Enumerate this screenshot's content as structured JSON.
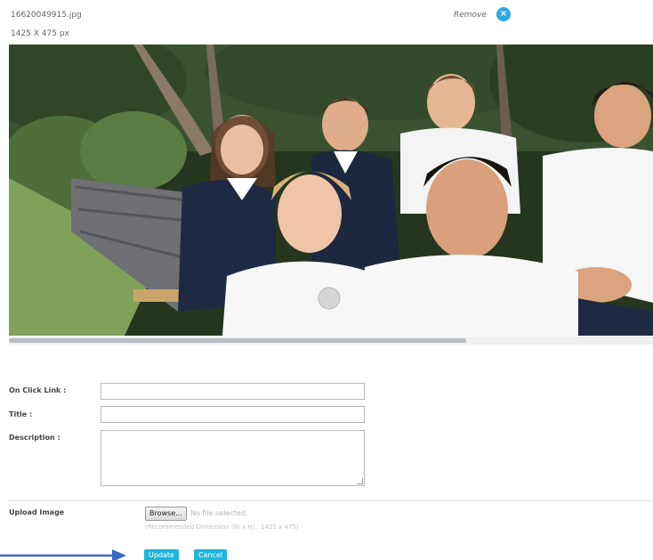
{
  "file": {
    "name": "16620049915.jpg",
    "dimensions": "1425 X 475 px"
  },
  "remove": {
    "label": "Remove",
    "icon": "close-circle-icon"
  },
  "photo": {
    "description_icon": "image"
  },
  "scrollbar": {
    "position_fraction": 0.0,
    "visible_fraction": 0.71
  },
  "form": {
    "on_click_link": {
      "label": "On Click Link :",
      "value": ""
    },
    "title": {
      "label": "Title :",
      "value": ""
    },
    "description": {
      "label": "Description :",
      "value": ""
    }
  },
  "upload": {
    "label": "Upload Image",
    "browse_label": "Browse...",
    "no_file_text": "No file selected.",
    "hint": "(Recommended Dimension (W x H) : 1425 x 475)"
  },
  "actions": {
    "update_label": "Update",
    "cancel_label": "Cancel"
  },
  "colors": {
    "accent": "#1fb6d9",
    "remove_icon": "#2fa8e6",
    "arrow": "#3a67c2"
  }
}
